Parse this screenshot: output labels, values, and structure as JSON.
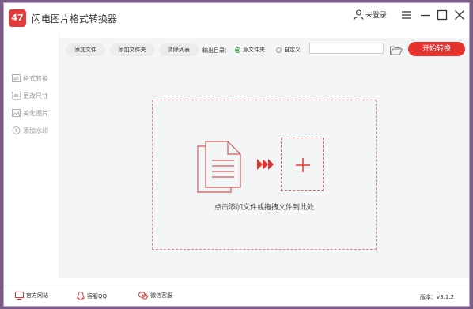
{
  "app": {
    "logo_text": "47",
    "title": "闪电图片格式转换器"
  },
  "user": {
    "label": "未登录"
  },
  "toolbar": {
    "add_file": "添加文件",
    "add_folder": "添加文件夹",
    "clear_list": "清除列表",
    "output_label": "输出目录：",
    "radio_source": "源文件夹",
    "radio_custom": "自定义",
    "selected_output": "源文件夹",
    "path_value": "",
    "start": "开始转换"
  },
  "sidebar": {
    "items": [
      {
        "label": "格式转换",
        "icon": "convert-icon"
      },
      {
        "label": "更改尺寸",
        "icon": "resize-icon"
      },
      {
        "label": "美化图片",
        "icon": "beautify-icon"
      },
      {
        "label": "添加水印",
        "icon": "watermark-icon"
      }
    ]
  },
  "main": {
    "drop_text": "点击添加文件或拖拽文件到此处"
  },
  "status": {
    "website": "官方网站",
    "qq": "客服QQ",
    "wechat": "微信客服",
    "version": "版本：v3.1.2"
  },
  "colors": {
    "accent": "#e6322f",
    "radio_on": "#3aa54a",
    "border": "#d98a8a"
  }
}
